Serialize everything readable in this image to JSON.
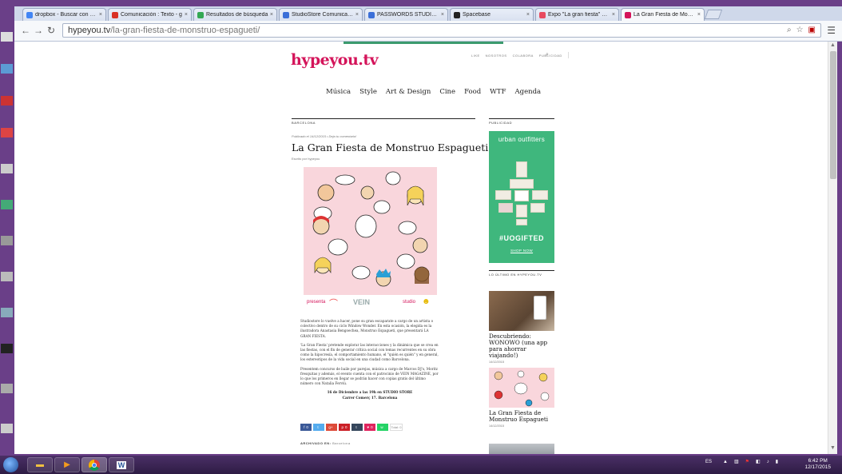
{
  "browser": {
    "tabs": [
      {
        "label": "dropbox - Buscar con Goo",
        "fav": "#4285f4"
      },
      {
        "label": "Comunicación : Texto - g",
        "fav": "#d93025"
      },
      {
        "label": "Resultados de búsqueda",
        "fav": "#34a853"
      },
      {
        "label": "StudioStore Comunicació",
        "fav": "#3b6fd8"
      },
      {
        "label": "PASSWORDS STUDIOSTO",
        "fav": "#3b6fd8"
      },
      {
        "label": "Spacebase",
        "fav": "#222222"
      },
      {
        "label": "Expo \"La gran fiesta\" de M",
        "fav": "#e84a5f"
      },
      {
        "label": "La Gran Fiesta de Monstru",
        "fav": "#d4145a",
        "active": true
      }
    ],
    "url_host": "hypeyou.tv",
    "url_path": "/la-gran-fiesta-de-monstruo-espagueti/"
  },
  "site": {
    "logo": "hypeyou.tv",
    "topnav": [
      "LIKE",
      "NOSOTROS",
      "COLABORA",
      "PUBLICIDAD"
    ],
    "mainnav": [
      "Música",
      "Style",
      "Art & Design",
      "Cine",
      "Food",
      "WTF",
      "Agenda"
    ]
  },
  "article": {
    "category": "BARCELONA",
    "meta": "Publicado el 14/12/2015   •   Deja tu comentario!",
    "title": "La Gran Fiesta de Monstruo Espagueti",
    "byline": "Escrito por hypeyou",
    "strip": [
      "presenta",
      "VEIN",
      "studio"
    ],
    "p1": "Studiostore lo vuelve a hacer, pone su gran escaparate a cargo de un artista o colectivo dentro de su ciclo Window Wonder. En esta ocasión, la elegida es la ilustradora Anastasia Bengoechea, Monstruo Espagueti, que presentará LA GRAN FIESTA.",
    "p2": "'La Gran Fiesta' pretende explorar las interacciones y la dinámica que se crea en las fiestas, con el fin de generar crítica social con temas recurrentes en su obra como la hipocresía, el comportamiento humano, el \"quién es quién\" y en general, los estereotipos de la vida social en una ciudad como Barcelona.",
    "p3": "Presentem concurso de baile por parejas, música a cargo de Marcos DJ's, Moritz fresquitas y además, el evento cuenta con el patrocinio de VEIN MAGAZINE, por lo que los primeros en llegar se podrán hacer con copias gratis del último número con Natalia Ferviú.",
    "event_line1": "16 de Diciembre a las 19h en STUDIO STORE",
    "event_line2": "Carrer Comerç 17. Barcelona",
    "share": [
      {
        "icon": "f",
        "count": "0",
        "color": "#3b5998"
      },
      {
        "icon": "t",
        "count": "",
        "color": "#55acee"
      },
      {
        "icon": "g+",
        "count": "",
        "color": "#dd4b39"
      },
      {
        "icon": "p",
        "count": "0",
        "color": "#cb2027"
      },
      {
        "icon": "t",
        "count": "",
        "color": "#35465c"
      },
      {
        "icon": "♥",
        "count": "0",
        "color": "#e0245e"
      },
      {
        "icon": "w",
        "count": "",
        "color": "#25d366"
      }
    ],
    "share_total": "Total: 0",
    "archived_label": "ARCHIVADO EN:",
    "archived_value": "Barcelona"
  },
  "sidebar": {
    "ad_heading": "PUBLICIDAD",
    "ad_brand": "urban outfitters",
    "ad_tag": "#UOGIFTED",
    "ad_shop": "SHOP NOW",
    "latest_heading": "LO ÚLTIMO EN HYPEYOU.TV",
    "posts": [
      {
        "title": "Descubriendo: WONOWO (una app para ahorrar viajando!)",
        "date": "14/12/2015"
      },
      {
        "title": "La Gran Fiesta de Monstruo Espagueti",
        "date": "14/12/2015"
      }
    ]
  },
  "taskbar": {
    "lang": "ES",
    "time": "6:42 PM",
    "date": "12/17/2015"
  }
}
